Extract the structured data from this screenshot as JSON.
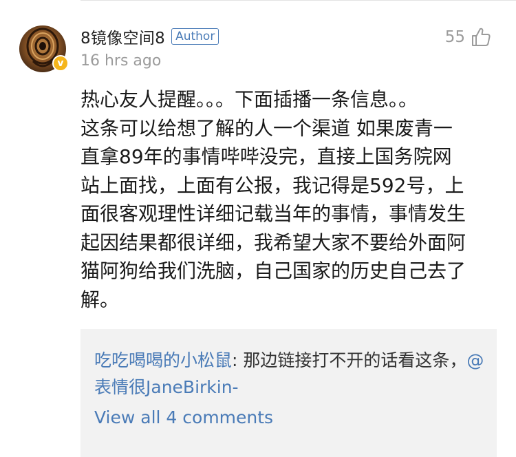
{
  "comment": {
    "username": "8镜像空间8",
    "author_tag": "Author",
    "verified_glyph": "v",
    "timestamp": "16 hrs ago",
    "like_count": "55",
    "like_icon": "thumbs-up-icon",
    "body": "热心友人提醒。。。下面插播一条信息。。\n这条可以给想了解的人一个渠道 如果废青一\n直拿89年的事情哔哔没完，直接上国务院网\n站上面找，上面有公报，我记得是592号，上\n面很客观理性详细记载当年的事情，事情发生\n起因结果都很详细，我希望大家不要给外面阿\n猫阿狗给我们洗脑，自己国家的历史自己去了\n解。"
  },
  "reply": {
    "user": "吃吃喝喝的小松鼠",
    "separator": ": ",
    "text": "那边链接打不开的话看这条，",
    "mention": "@表情很JaneBirkin-",
    "view_all_label": "View all 4 comments"
  },
  "colors": {
    "link_blue": "#4a7bb7",
    "badge_gold": "#f5b51b",
    "muted_gray": "#9b9b9b",
    "reply_bg": "#f2f2f2"
  }
}
